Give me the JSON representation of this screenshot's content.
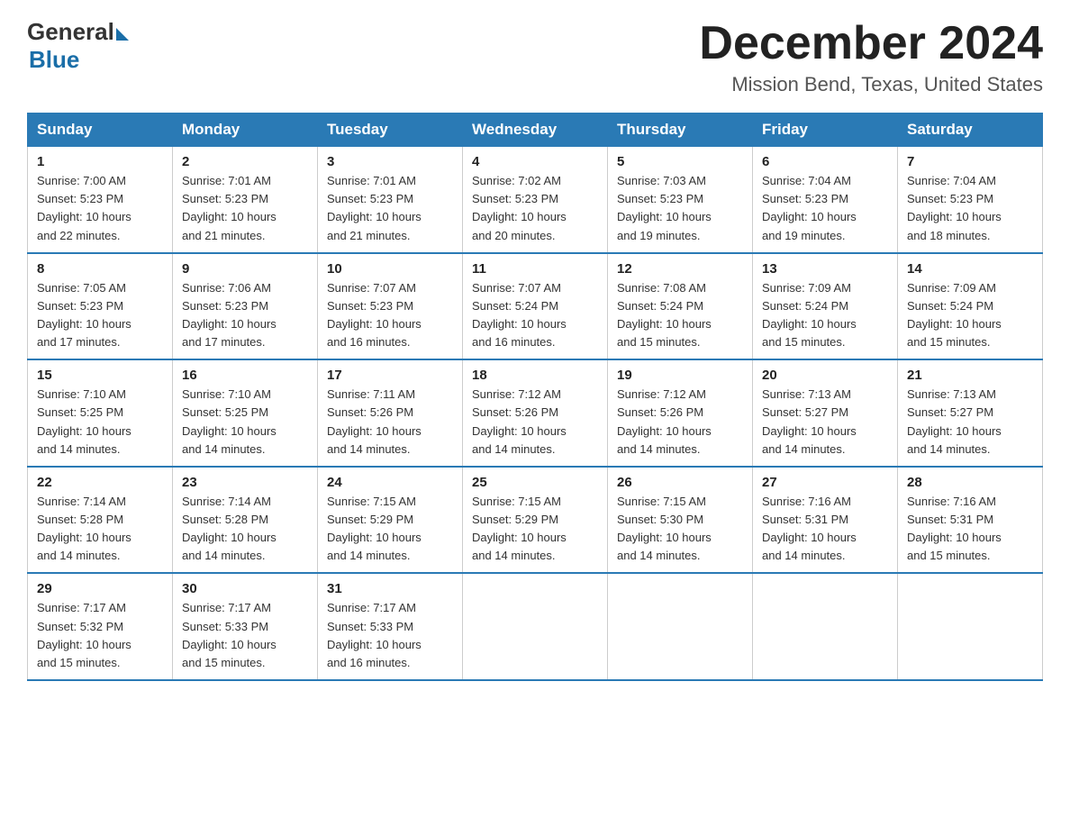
{
  "header": {
    "logo_general": "General",
    "logo_blue": "Blue",
    "month_title": "December 2024",
    "location": "Mission Bend, Texas, United States"
  },
  "days_of_week": [
    "Sunday",
    "Monday",
    "Tuesday",
    "Wednesday",
    "Thursday",
    "Friday",
    "Saturday"
  ],
  "weeks": [
    [
      {
        "num": "1",
        "sunrise": "7:00 AM",
        "sunset": "5:23 PM",
        "daylight": "10 hours and 22 minutes."
      },
      {
        "num": "2",
        "sunrise": "7:01 AM",
        "sunset": "5:23 PM",
        "daylight": "10 hours and 21 minutes."
      },
      {
        "num": "3",
        "sunrise": "7:01 AM",
        "sunset": "5:23 PM",
        "daylight": "10 hours and 21 minutes."
      },
      {
        "num": "4",
        "sunrise": "7:02 AM",
        "sunset": "5:23 PM",
        "daylight": "10 hours and 20 minutes."
      },
      {
        "num": "5",
        "sunrise": "7:03 AM",
        "sunset": "5:23 PM",
        "daylight": "10 hours and 19 minutes."
      },
      {
        "num": "6",
        "sunrise": "7:04 AM",
        "sunset": "5:23 PM",
        "daylight": "10 hours and 19 minutes."
      },
      {
        "num": "7",
        "sunrise": "7:04 AM",
        "sunset": "5:23 PM",
        "daylight": "10 hours and 18 minutes."
      }
    ],
    [
      {
        "num": "8",
        "sunrise": "7:05 AM",
        "sunset": "5:23 PM",
        "daylight": "10 hours and 17 minutes."
      },
      {
        "num": "9",
        "sunrise": "7:06 AM",
        "sunset": "5:23 PM",
        "daylight": "10 hours and 17 minutes."
      },
      {
        "num": "10",
        "sunrise": "7:07 AM",
        "sunset": "5:23 PM",
        "daylight": "10 hours and 16 minutes."
      },
      {
        "num": "11",
        "sunrise": "7:07 AM",
        "sunset": "5:24 PM",
        "daylight": "10 hours and 16 minutes."
      },
      {
        "num": "12",
        "sunrise": "7:08 AM",
        "sunset": "5:24 PM",
        "daylight": "10 hours and 15 minutes."
      },
      {
        "num": "13",
        "sunrise": "7:09 AM",
        "sunset": "5:24 PM",
        "daylight": "10 hours and 15 minutes."
      },
      {
        "num": "14",
        "sunrise": "7:09 AM",
        "sunset": "5:24 PM",
        "daylight": "10 hours and 15 minutes."
      }
    ],
    [
      {
        "num": "15",
        "sunrise": "7:10 AM",
        "sunset": "5:25 PM",
        "daylight": "10 hours and 14 minutes."
      },
      {
        "num": "16",
        "sunrise": "7:10 AM",
        "sunset": "5:25 PM",
        "daylight": "10 hours and 14 minutes."
      },
      {
        "num": "17",
        "sunrise": "7:11 AM",
        "sunset": "5:26 PM",
        "daylight": "10 hours and 14 minutes."
      },
      {
        "num": "18",
        "sunrise": "7:12 AM",
        "sunset": "5:26 PM",
        "daylight": "10 hours and 14 minutes."
      },
      {
        "num": "19",
        "sunrise": "7:12 AM",
        "sunset": "5:26 PM",
        "daylight": "10 hours and 14 minutes."
      },
      {
        "num": "20",
        "sunrise": "7:13 AM",
        "sunset": "5:27 PM",
        "daylight": "10 hours and 14 minutes."
      },
      {
        "num": "21",
        "sunrise": "7:13 AM",
        "sunset": "5:27 PM",
        "daylight": "10 hours and 14 minutes."
      }
    ],
    [
      {
        "num": "22",
        "sunrise": "7:14 AM",
        "sunset": "5:28 PM",
        "daylight": "10 hours and 14 minutes."
      },
      {
        "num": "23",
        "sunrise": "7:14 AM",
        "sunset": "5:28 PM",
        "daylight": "10 hours and 14 minutes."
      },
      {
        "num": "24",
        "sunrise": "7:15 AM",
        "sunset": "5:29 PM",
        "daylight": "10 hours and 14 minutes."
      },
      {
        "num": "25",
        "sunrise": "7:15 AM",
        "sunset": "5:29 PM",
        "daylight": "10 hours and 14 minutes."
      },
      {
        "num": "26",
        "sunrise": "7:15 AM",
        "sunset": "5:30 PM",
        "daylight": "10 hours and 14 minutes."
      },
      {
        "num": "27",
        "sunrise": "7:16 AM",
        "sunset": "5:31 PM",
        "daylight": "10 hours and 14 minutes."
      },
      {
        "num": "28",
        "sunrise": "7:16 AM",
        "sunset": "5:31 PM",
        "daylight": "10 hours and 15 minutes."
      }
    ],
    [
      {
        "num": "29",
        "sunrise": "7:17 AM",
        "sunset": "5:32 PM",
        "daylight": "10 hours and 15 minutes."
      },
      {
        "num": "30",
        "sunrise": "7:17 AM",
        "sunset": "5:33 PM",
        "daylight": "10 hours and 15 minutes."
      },
      {
        "num": "31",
        "sunrise": "7:17 AM",
        "sunset": "5:33 PM",
        "daylight": "10 hours and 16 minutes."
      },
      null,
      null,
      null,
      null
    ]
  ],
  "labels": {
    "sunrise": "Sunrise:",
    "sunset": "Sunset:",
    "daylight": "Daylight:"
  }
}
